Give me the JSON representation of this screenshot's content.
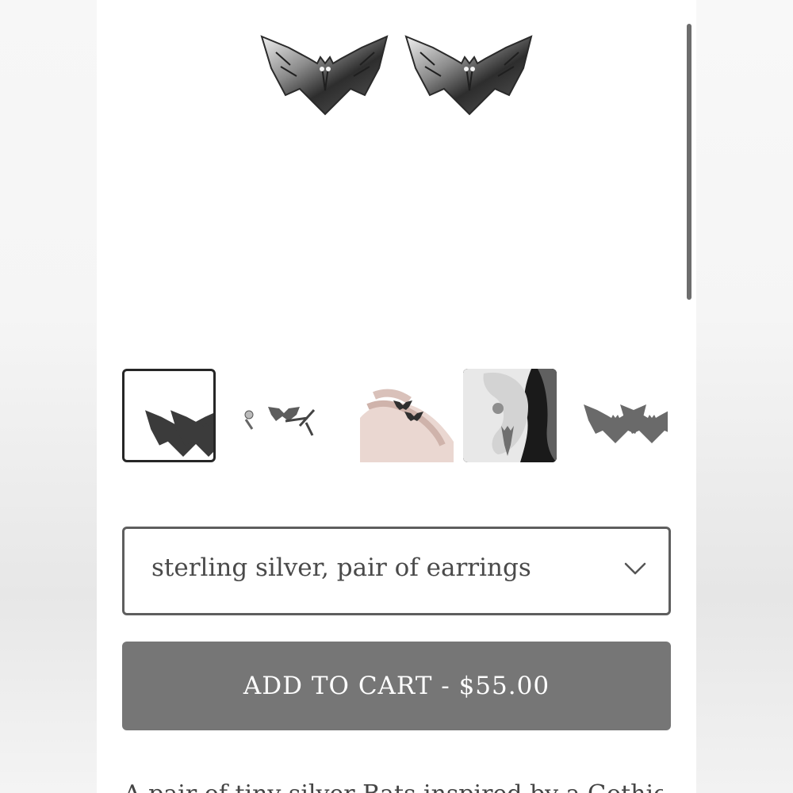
{
  "product": {
    "variant_select": {
      "selected_value": "sterling silver, pair of earrings"
    },
    "add_to_cart": {
      "label": "ADD TO CART - $55.00"
    },
    "description_partial": "A pair of tiny silver Bats inspired by a Gothic"
  },
  "icons": {
    "chevron": "chevron-down-icon"
  },
  "colors": {
    "button_bg": "#767676",
    "select_border": "#5e5e5e",
    "selected_thumb_border": "#262626",
    "scrollbar": "#6d6d6d"
  }
}
